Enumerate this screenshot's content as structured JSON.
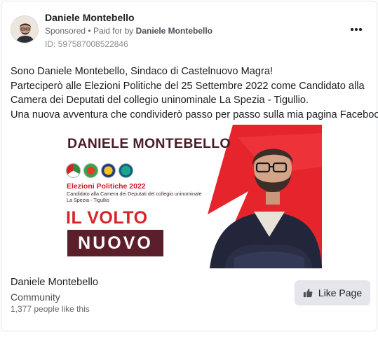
{
  "post": {
    "author": "Daniele Montebello",
    "sponsored_label": "Sponsored",
    "paid_prefix": "Paid for by",
    "paid_by": "Daniele Montebello",
    "separator": "•",
    "ad_id": "ID: 597587008522846",
    "body_lines": [
      "Sono Daniele Montebello, Sindaco di Castelnuovo Magra!",
      "Parteciperò alle Elezioni Politiche del 25 Settembre 2022 come Candidato alla",
      "Camera dei Deputati del collegio uninominale La Spezia - Tigullio.",
      "Una nuova avventura che condividerò passo per passo sulla mia pagina Facebook."
    ],
    "more_icon": "ellipsis-icon"
  },
  "creative": {
    "name": "DANIELE MONTEBELLO",
    "election": "Elezioni Politiche 2022",
    "candidate_line1": "Candidato alla Camera dei Deputati del collegio uninominale",
    "candidate_line2": "La Spezia - Tigullio",
    "slogan_top": "IL VOLTO",
    "slogan_bottom": "NUOVO",
    "colors": {
      "red": "#d8232a",
      "burgundy": "#5a1f2a"
    }
  },
  "page": {
    "name": "Daniele Montebello",
    "category": "Community",
    "likes": "1,377 people like this",
    "like_button": "Like Page",
    "like_icon": "thumbs-up-icon"
  }
}
